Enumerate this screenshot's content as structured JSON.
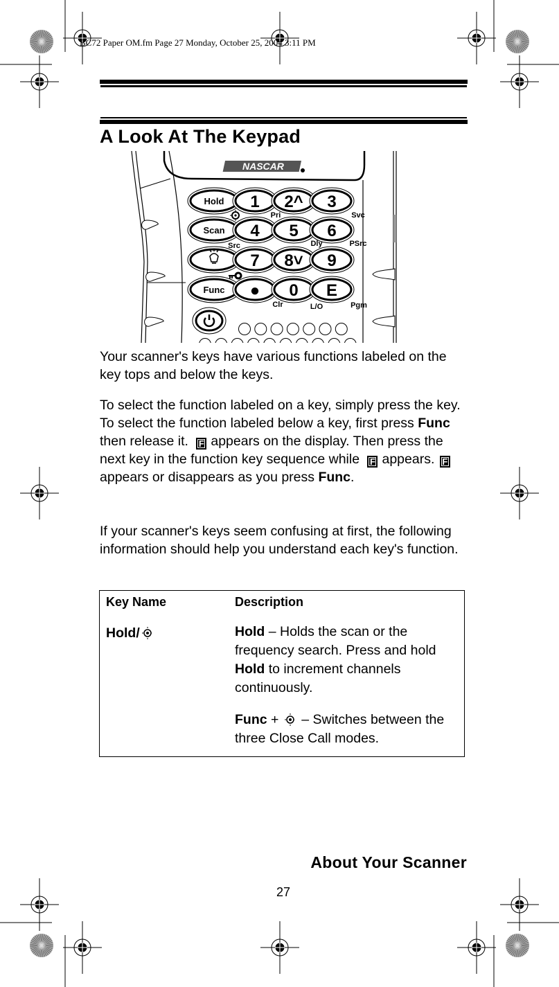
{
  "header": {
    "print_info": "BC72 Paper OM.fm  Page 27  Monday, October 25, 2004  3:11 PM"
  },
  "section_title": "A Look At The Keypad",
  "keypad_image": {
    "brand": "NASCAR",
    "keys": [
      {
        "top": "Hold",
        "below": "close-call-icon"
      },
      {
        "top": "1",
        "below": "Pri"
      },
      {
        "top": "2^",
        "below": ""
      },
      {
        "top": "3",
        "below": "Svc"
      },
      {
        "top": "Scan",
        "below": "Src"
      },
      {
        "top": "4",
        "below": ""
      },
      {
        "top": "5",
        "below": "Dly"
      },
      {
        "top": "6",
        "below": "PSrc"
      },
      {
        "top": "light-icon",
        "below": "key-lock-icon"
      },
      {
        "top": "7",
        "below": ""
      },
      {
        "top": "8v",
        "below": ""
      },
      {
        "top": "9",
        "below": ""
      },
      {
        "top": "Func",
        "below": ""
      },
      {
        "top": "•",
        "below": "Clr"
      },
      {
        "top": "0",
        "below": "L/O"
      },
      {
        "top": "E",
        "below": "Pgm"
      },
      {
        "top": "power-icon",
        "below": ""
      }
    ],
    "labels": {
      "hold": "Hold",
      "k1": "1",
      "k2": "2",
      "k3": "3",
      "scan": "Scan",
      "k4": "4",
      "k5": "5",
      "k6": "6",
      "k7": "7",
      "k8": "8",
      "k9": "9",
      "func": "Func",
      "k0": "0",
      "kE": "E",
      "pri": "Pri",
      "svc": "Svc",
      "src": "Src",
      "dly": "Dly",
      "psrc": "PSrc",
      "clr": "Clr",
      "lo": "L/O",
      "pgm": "Pgm"
    }
  },
  "paragraphs": {
    "p1": "Your scanner's keys have various functions labeled on the key tops and below the keys.",
    "p2_a": "To select the function labeled on a key, simply press the key. To select the function labeled below a key, first press ",
    "p2_func1": "Func",
    "p2_b": " then release it.",
    "p2_icon": "F",
    "p2_c": "appears on the display. Then press the next key in the function key sequence while",
    "p2_d": "appears.",
    "p2_e": "appears or disappears as you press ",
    "p2_func2": "Func",
    "p2_f": ".",
    "p3": "If your scanner's keys seem confusing at first, the following information should help you understand each key's function."
  },
  "table": {
    "headers": [
      "Key Name",
      "Description"
    ],
    "rows": [
      {
        "key_name": "Hold/",
        "key_icon": "close-call-icon",
        "desc1_bold": "Hold",
        "desc1_text": " – Holds the scan or the frequency search. Press and hold ",
        "desc1_bold2": "Hold",
        "desc1_text2": " to increment channels continuously.",
        "desc2_bold": "Func",
        "desc2_plus": " + ",
        "desc2_icon": "close-call-icon",
        "desc2_text": " – Switches between the three Close Call modes."
      }
    ]
  },
  "footer": {
    "section_name": "About Your Scanner",
    "page_number": "27"
  }
}
